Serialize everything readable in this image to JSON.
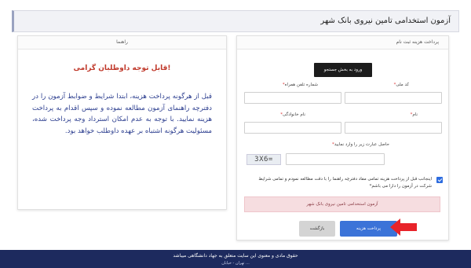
{
  "header": {
    "title": "آزمون استخدامی تامین نیروی بانک شهر"
  },
  "guide_panel": {
    "title": "راهنما",
    "notice_title": "قابل توجه داوطلبان گرامی!",
    "notice_body": "قبل از هرگونه پرداخت هزینه، ابتدا شرایط و ضوابط آزمون را در دفترچه راهنمای آزمون مطالعه نموده و سپس اقدام به پرداخت هزینه نمایید. با توجه به عدم امکان استرداد وجه پرداخت شده، مسئولیت هرگونه اشتباه بر عهده داوطلب خواهد بود."
  },
  "form_panel": {
    "title": "پرداخت هزینه ثبت نام",
    "search_button": "ورود به بخش جستجو",
    "national_code_label": "کد ملی",
    "phone_label": "شماره تلفن همراه",
    "first_name_label": "نام",
    "last_name_label": "نام خانوادگی",
    "captcha_label": "حاصل عبارت زیر را وارد نمایید",
    "captcha_text": "3X6=",
    "required_mark": "*",
    "agreement_text": "اینجانب قبل از پرداخت هزینه تمامی مفاد دفترچه راهنما را با دقت مطالعه نمودم و تمامی شرایط شرکت در آزمون را دارا می باشم*",
    "alert_text": "آزمون استخدامی تامین نیروی بانک شهر",
    "pay_button": "پرداخت هزینه",
    "back_button": "بازگشت"
  },
  "footer": {
    "line1": "حقوق مادی و معنوی این سایت متعلق به جهاد دانشگاهی میباشد",
    "line2": "تهران - خیابان ..."
  },
  "colors": {
    "accent": "#3b73d8",
    "alert_bg": "#f6dde0",
    "notice_title": "#c0392b",
    "notice_body": "#2c3e8f",
    "footer_bg": "#1d2a5e",
    "arrow": "#e8232a"
  },
  "icons": {
    "pointer": "red-arrow-icon",
    "checkbox": "checkbox-checked-icon"
  }
}
